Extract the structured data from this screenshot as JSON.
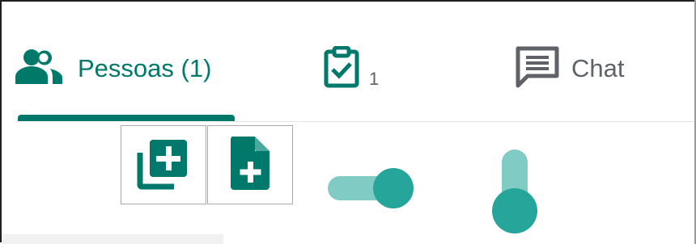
{
  "tabs": {
    "people": {
      "label": "Pessoas (1)",
      "icon": "people-icon",
      "active": true
    },
    "tasks": {
      "count": "1",
      "icon": "task-checklist-icon"
    },
    "chat": {
      "label": "Chat",
      "icon": "chat-icon"
    }
  },
  "toolbar": {
    "add_multiple_icon": "add-to-collection-icon",
    "add_file_icon": "add-document-icon"
  },
  "toggles": {
    "horizontal": {
      "state": "on"
    },
    "vertical": {
      "state": "on"
    }
  },
  "colors": {
    "accent": "#00796b",
    "toggle_thumb": "#26a69a",
    "toggle_track": "#80cbc4",
    "text_muted": "#5f6368"
  }
}
